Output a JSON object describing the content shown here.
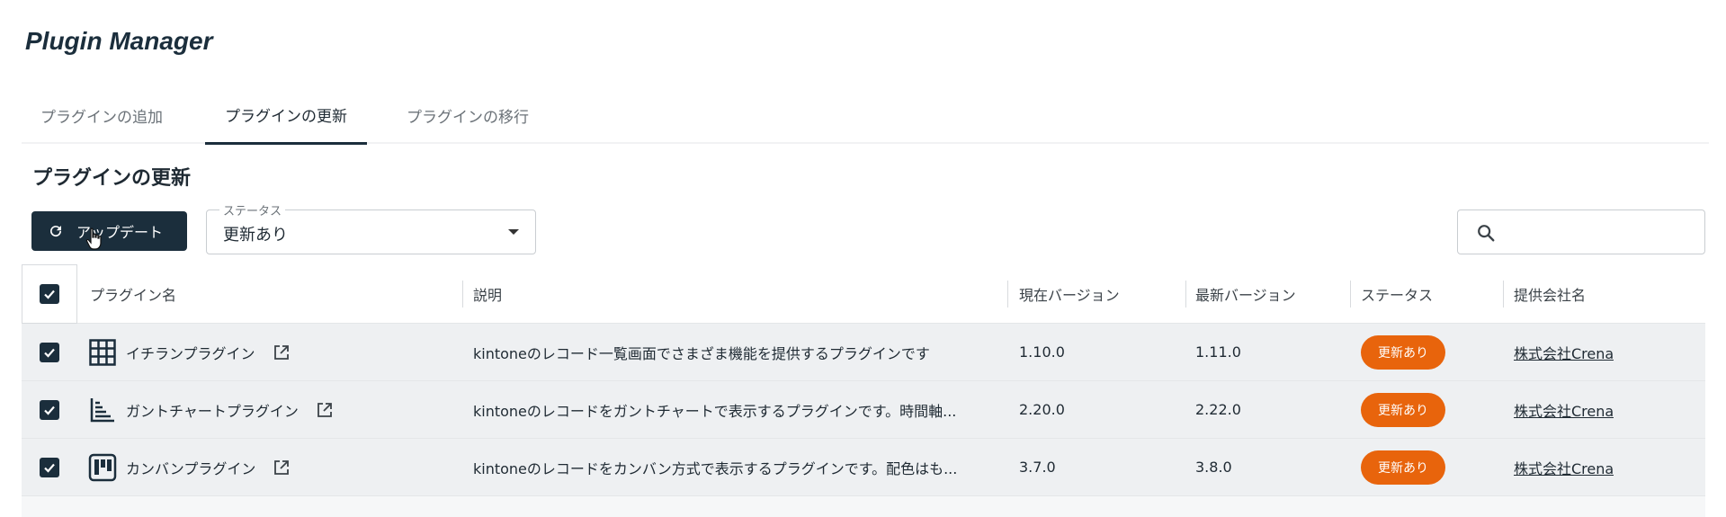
{
  "app": {
    "title": "Plugin Manager"
  },
  "tabs": [
    {
      "label": "プラグインの追加"
    },
    {
      "label": "プラグインの更新"
    },
    {
      "label": "プラグインの移行"
    }
  ],
  "section": {
    "title": "プラグインの更新"
  },
  "toolbar": {
    "update_label": "アップデート",
    "status_legend": "ステータス",
    "status_value": "更新あり"
  },
  "search": {
    "placeholder": ""
  },
  "table": {
    "headers": {
      "name": "プラグイン名",
      "description": "説明",
      "current_version": "現在バージョン",
      "latest_version": "最新バージョン",
      "status": "ステータス",
      "vendor": "提供会社名"
    },
    "rows": [
      {
        "name": "イチランプラグイン",
        "icon": "grid-icon",
        "description": "kintoneのレコード一覧画面でさまざま機能を提供するプラグインです",
        "current_version": "1.10.0",
        "latest_version": "1.11.0",
        "status": "更新あり",
        "vendor": "株式会社Crena"
      },
      {
        "name": "ガントチャートプラグイン",
        "icon": "gantt-icon",
        "description": "kintoneのレコードをガントチャートで表示するプラグインです。時間軸...",
        "current_version": "2.20.0",
        "latest_version": "2.22.0",
        "status": "更新あり",
        "vendor": "株式会社Crena"
      },
      {
        "name": "カンバンプラグイン",
        "icon": "kanban-icon",
        "description": "kintoneのレコードをカンバン方式で表示するプラグインです。配色はも...",
        "current_version": "3.7.0",
        "latest_version": "3.8.0",
        "status": "更新あり",
        "vendor": "株式会社Crena"
      }
    ]
  },
  "colors": {
    "primary": "#1b2e3c",
    "status_badge": "#e8640c",
    "row_selected_bg": "#eef0f2"
  }
}
